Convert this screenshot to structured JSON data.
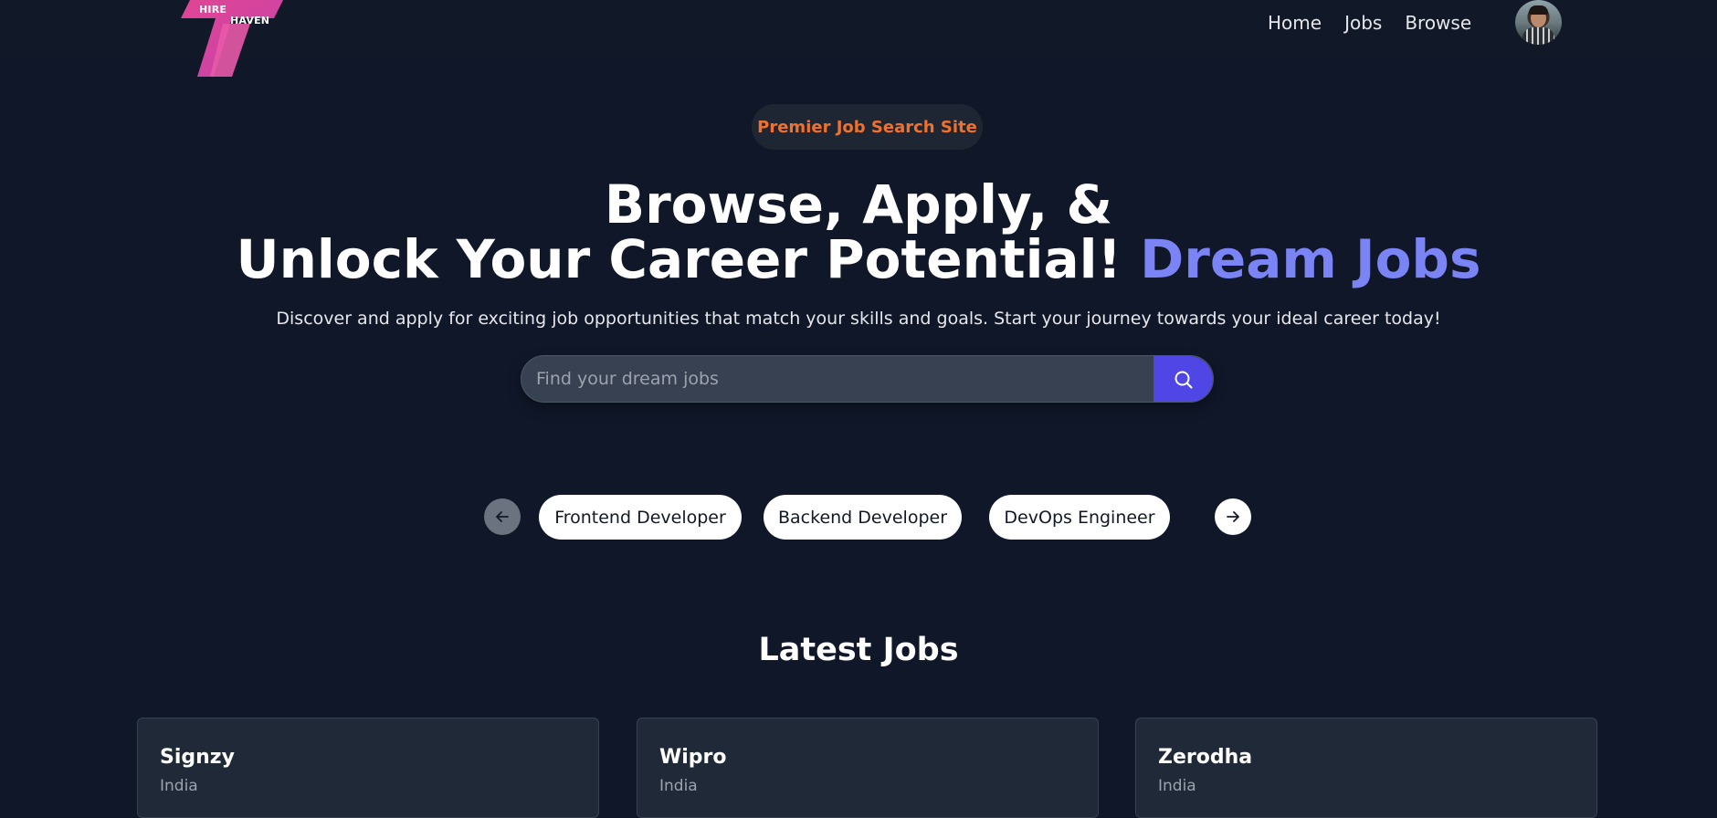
{
  "navbar": {
    "logo": {
      "line1": "HIRE",
      "line2": "HAVEN"
    },
    "links": [
      "Home",
      "Jobs",
      "Browse"
    ],
    "avatar_icon": "user-avatar"
  },
  "hero": {
    "badge": "Premier Job Search Site",
    "headline_line1": "Browse, Apply, &",
    "headline_line2_prefix": "Unlock Your Career Potential!",
    "headline_line2_accent": "Dream Jobs",
    "subtext": "Discover and apply for exciting job opportunities that match your skills and goals. Start your journey towards your ideal career today!",
    "search": {
      "placeholder": "Find your dream jobs",
      "value": "",
      "button_icon": "search-icon"
    },
    "accent_color": "#7b84f4",
    "badge_color": "#f0712c",
    "button_color": "#4f46e5"
  },
  "categories": {
    "prev_icon": "arrow-left-icon",
    "next_icon": "arrow-right-icon",
    "items": [
      "Frontend Developer",
      "Backend Developer",
      "DevOps Engineer"
    ]
  },
  "latest_jobs": {
    "title": "Latest Jobs",
    "jobs": [
      {
        "company": "Signzy",
        "location": "India"
      },
      {
        "company": "Wipro",
        "location": "India"
      },
      {
        "company": "Zerodha",
        "location": "India"
      }
    ]
  }
}
